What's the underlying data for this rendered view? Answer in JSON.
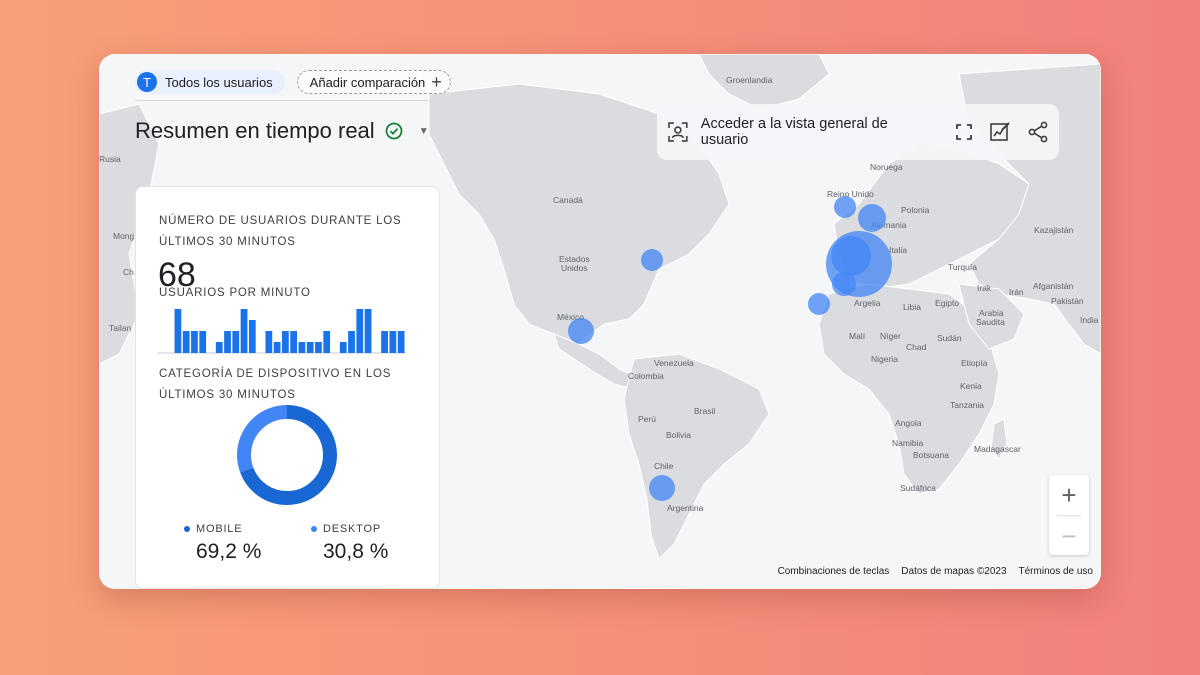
{
  "header": {
    "user_chip_avatar": "T",
    "user_chip_label": "Todos los usuarios",
    "compare_label": "Añadir comparación",
    "title": "Resumen en tiempo real"
  },
  "toolbar": {
    "user_overview_label": "Acceder a la vista general de usuario"
  },
  "card": {
    "users_label_line1": "NÚMERO DE USUARIOS DURANTE LOS",
    "users_label_line2": "ÚLTIMOS 30 MINUTOS",
    "users_count": "68",
    "per_minute_label": "USUARIOS POR MINUTO",
    "device_label_line1": "CATEGORÍA DE DISPOSITIVO EN LOS",
    "device_label_line2": "ÚLTIMOS 30 MINUTOS",
    "devices": [
      {
        "name": "MOBILE",
        "value_label": "69,2 %",
        "share": 0.692,
        "color": "#1967d2"
      },
      {
        "name": "DESKTOP",
        "value_label": "30,8 %",
        "share": 0.308,
        "color": "#4285f4"
      }
    ]
  },
  "chart_data": {
    "type": "bar",
    "values": [
      0,
      0,
      4,
      2,
      2,
      2,
      0,
      1,
      2,
      2,
      4,
      3,
      0,
      2,
      1,
      2,
      2,
      1,
      1,
      1,
      2,
      0,
      1,
      2,
      4,
      4,
      0,
      2,
      2,
      2
    ],
    "bar_color": "#1a73e8",
    "donut_colors": [
      "#1967d2",
      "#4285f4"
    ]
  },
  "map": {
    "labels": {
      "greenland": "Groenlandia",
      "russia": "Rusia",
      "mongolia": "Mong",
      "china": "Ch",
      "taiwan": "Tailan",
      "canada": "Canadá",
      "usa_1": "Estados",
      "usa_2": "Unidos",
      "mexico": "México",
      "venezuela": "Venezuela",
      "colombia": "Colombia",
      "peru": "Perú",
      "brasil": "Brasil",
      "bolivia": "Bolivia",
      "chile": "Chile",
      "argentina": "Argentina",
      "norway": "Noruega",
      "uk": "Reino Unido",
      "poland": "Polonia",
      "germany": "Alemania",
      "italy": "Italia",
      "turkey": "Turquía",
      "kazakhstan": "Kazajistán",
      "afghanistan": "Afganistán",
      "pakistan": "Pakistán",
      "india": "India",
      "iraq": "Irak",
      "iran": "Irán",
      "algeria": "Argelia",
      "libya": "Libia",
      "egypt": "Egipto",
      "saudi_1": "Arabia",
      "saudi_2": "Saudita",
      "mali": "Malí",
      "niger": "Níger",
      "chad": "Chad",
      "sudan": "Sudán",
      "nigeria": "Nigeria",
      "ethiopia": "Etiopía",
      "kenya": "Kenia",
      "tanzania": "Tanzania",
      "angola": "Angola",
      "namibia": "Namibia",
      "botswana": "Botsuana",
      "madagascar": "Madagascar",
      "south_africa": "Sudáfrica"
    },
    "zoom_in": "+",
    "zoom_out": "−"
  },
  "footer": {
    "shortcuts": "Combinaciones de teclas",
    "map_data": "Datos de mapas ©2023",
    "terms": "Términos de uso"
  }
}
